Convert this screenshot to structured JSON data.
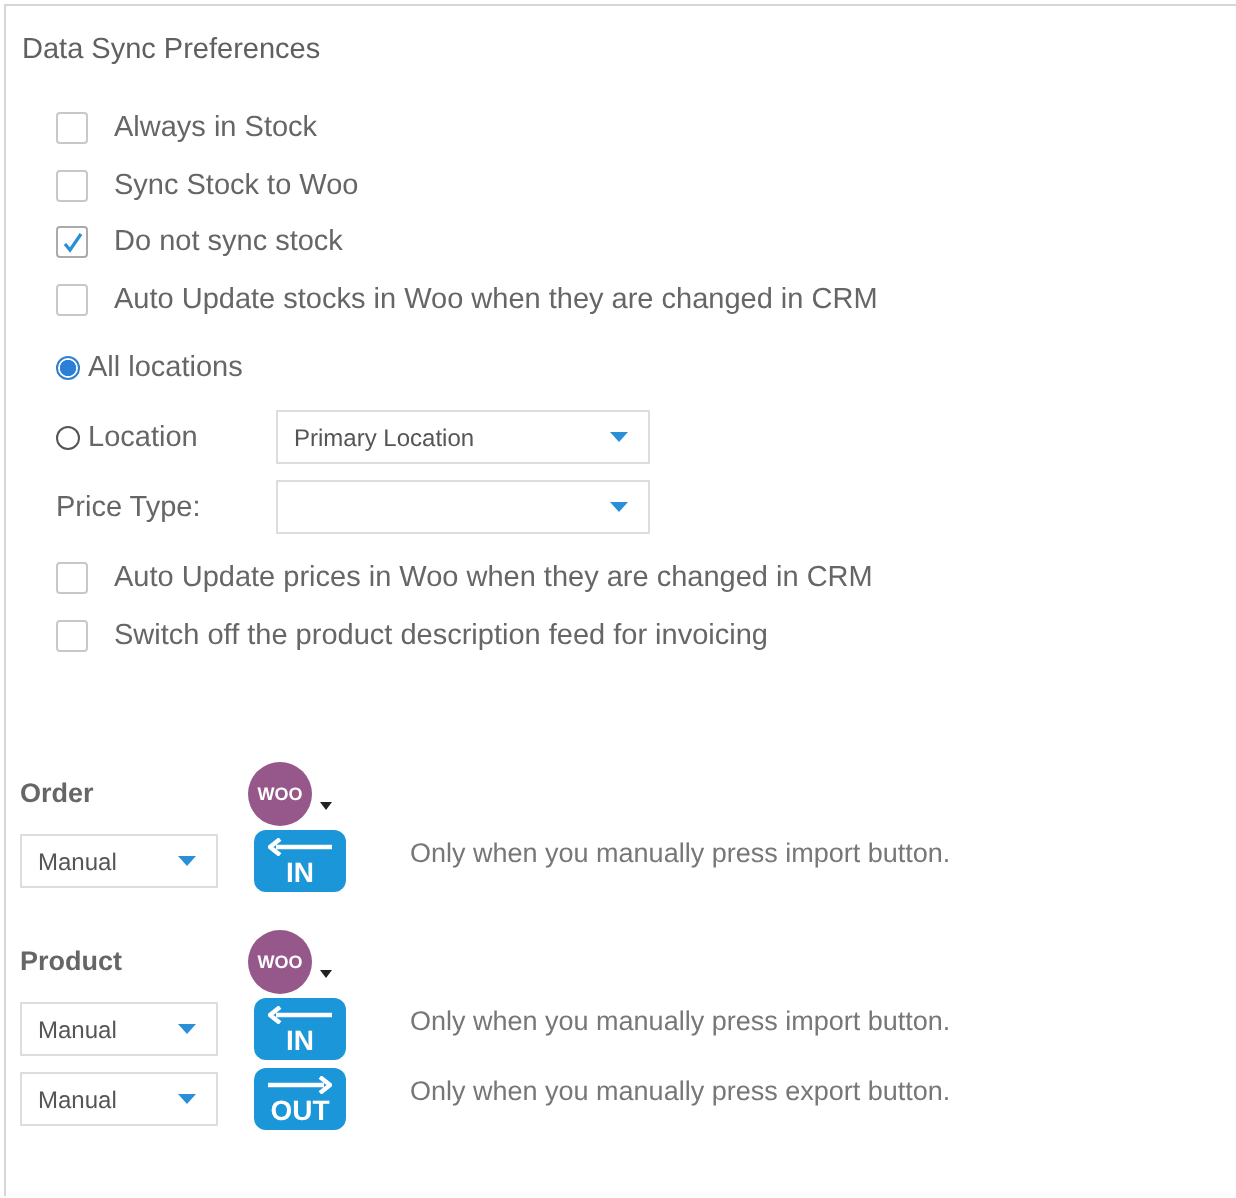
{
  "title": "Data Sync Preferences",
  "stock_options": [
    {
      "label": "Always in Stock",
      "checked": false
    },
    {
      "label": "Sync Stock to Woo",
      "checked": false
    },
    {
      "label": "Do not sync stock",
      "checked": true
    },
    {
      "label": "Auto Update stocks in Woo when they are changed in CRM",
      "checked": false
    }
  ],
  "locations": [
    {
      "label": "All locations",
      "selected": true
    },
    {
      "label": "Location",
      "selected": false,
      "dropdown": "Primary Location"
    }
  ],
  "price_type": {
    "label": "Price Type:"
  },
  "price_options": [
    {
      "label": "Auto Update prices in Woo when they are changed in CRM",
      "checked": false
    },
    {
      "label": "Switch off the product description feed for invoicing",
      "checked": false
    }
  ],
  "sync_sections": [
    {
      "title": "Order",
      "badge": "WOO",
      "rows": [
        {
          "mode": "Manual",
          "kind": "in",
          "button": "IN",
          "description": "Only when you manually press import button."
        }
      ]
    },
    {
      "title": "Product",
      "badge": "WOO",
      "rows": [
        {
          "mode": "Manual",
          "kind": "in",
          "button": "IN",
          "description": "Only when you manually press import button."
        },
        {
          "mode": "Manual",
          "kind": "out",
          "button": "OUT",
          "description": "Only when you manually press export button."
        }
      ]
    }
  ]
}
